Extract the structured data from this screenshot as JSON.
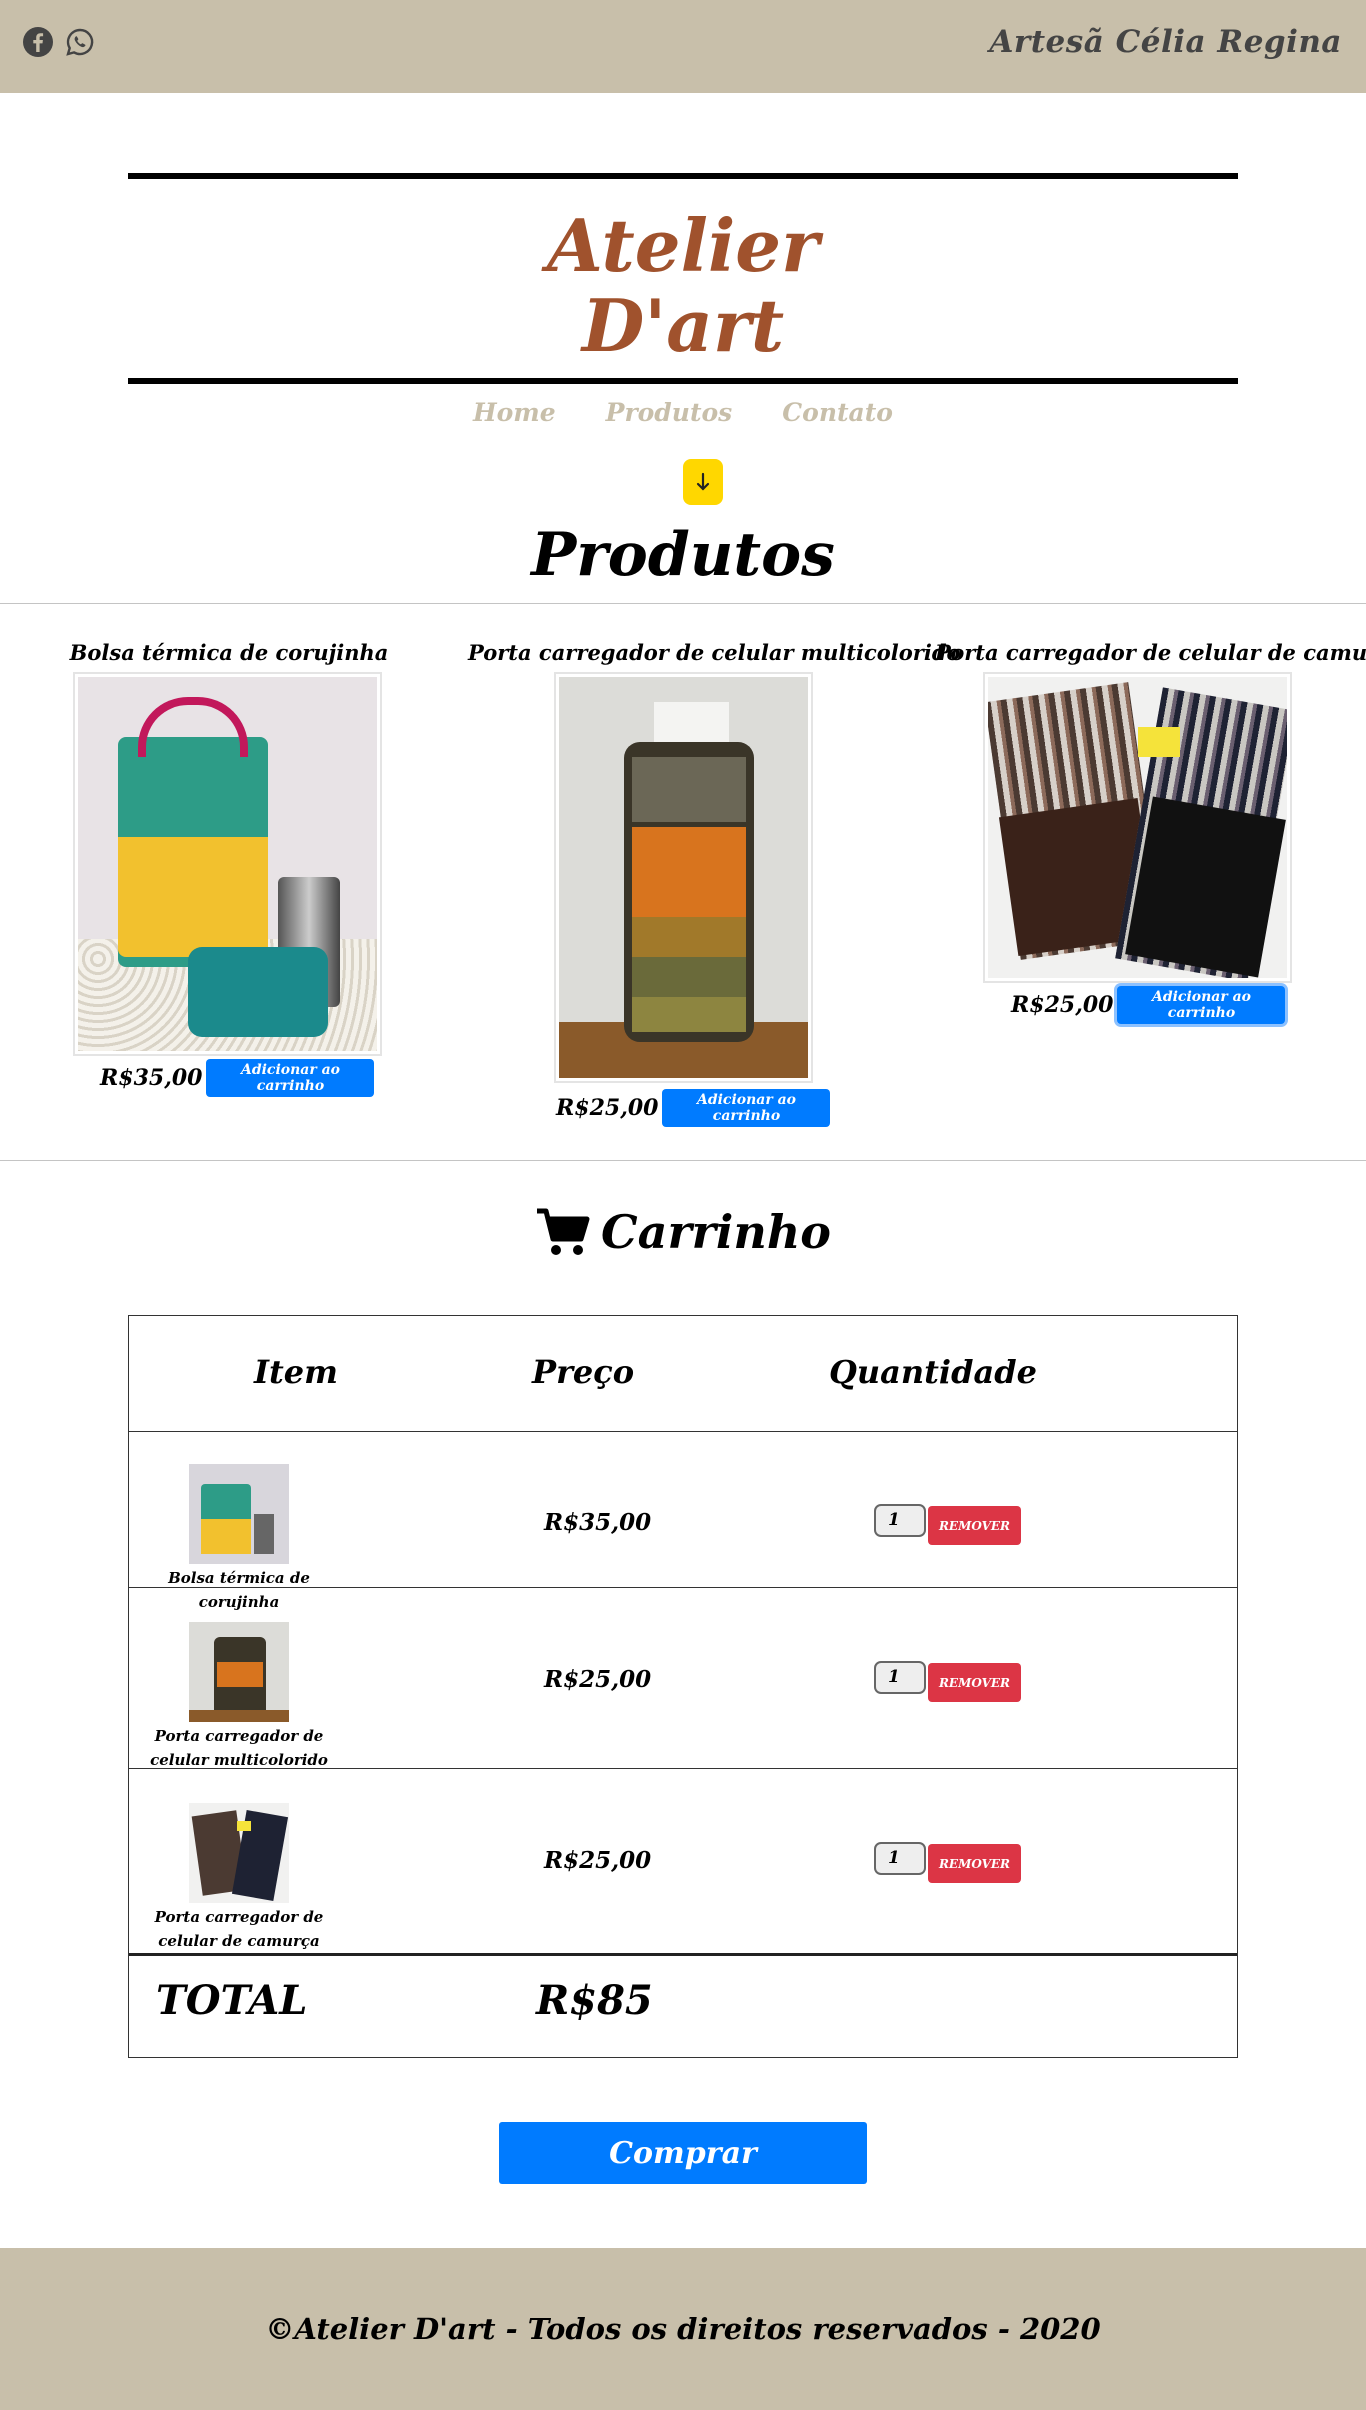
{
  "topbar": {
    "artist": "Artesã  Célia  Regina",
    "icons": [
      "facebook-icon",
      "whatsapp-icon"
    ]
  },
  "logo": {
    "line1": "Atelier",
    "line2": "D'art"
  },
  "nav": {
    "items": [
      "Home",
      "Produtos",
      "Contato"
    ]
  },
  "products_section": {
    "title": "Produtos",
    "items": [
      {
        "name": "Bolsa térmica de corujinha",
        "price": "R$35,00",
        "button": "Adicionar ao carrinho"
      },
      {
        "name": "Porta carregador de celular multicolorido",
        "price": "R$25,00",
        "button": "Adicionar ao carrinho"
      },
      {
        "name": "Porta carregador de celular de camurça",
        "price": "R$25,00",
        "button": "Adicionar ao carrinho"
      }
    ]
  },
  "cart": {
    "title": "Carrinho",
    "headers": {
      "item": "Item",
      "price": "Preço",
      "quantity": "Quantidade"
    },
    "rows": [
      {
        "name": "Bolsa térmica de corujinha",
        "price": "R$35,00",
        "qty": "1",
        "remove": "REMOVER"
      },
      {
        "name": "Porta carregador de celular multicolorido",
        "price": "R$25,00",
        "qty": "1",
        "remove": "REMOVER"
      },
      {
        "name": "Porta carregador de celular de camurça",
        "price": "R$25,00",
        "qty": "1",
        "remove": "REMOVER"
      }
    ],
    "total_label": "TOTAL",
    "total_value": "R$85",
    "buy_button": "Comprar"
  },
  "footer": {
    "text": "©Atelier D'art - Todos os direitos reservados - 2020"
  },
  "colors": {
    "topbar": "#c8bfaa",
    "logo": "#a0522d",
    "primary": "#007bff",
    "danger": "#dc3545",
    "arrow": "#ffd700"
  }
}
